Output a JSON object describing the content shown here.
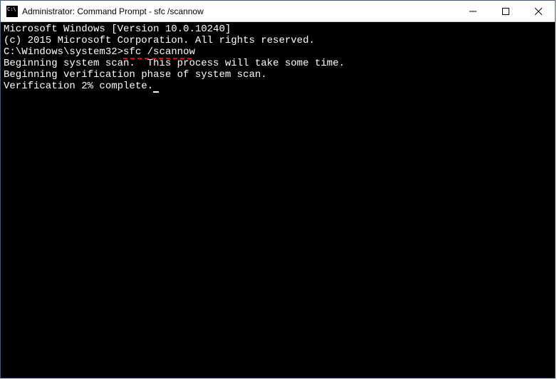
{
  "titlebar": {
    "title": "Administrator: Command Prompt - sfc  /scannow"
  },
  "terminal": {
    "line1": "Microsoft Windows [Version 10.0.10240]",
    "line2": "(c) 2015 Microsoft Corporation. All rights reserved.",
    "blank1": "",
    "prompt": "C:\\Windows\\system32>",
    "command": "sfc /scannow",
    "blank2": "",
    "line3": "Beginning system scan.  This process will take some time.",
    "blank3": "",
    "line4": "Beginning verification phase of system scan.",
    "line5": "Verification 2% complete."
  }
}
